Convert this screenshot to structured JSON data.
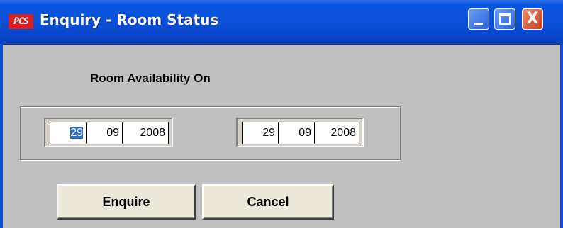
{
  "window": {
    "app_logo": "PCS",
    "title": "Enquiry - Room Status",
    "controls": {
      "minimize_icon": "minimize-icon",
      "maximize_icon": "maximize-icon",
      "close_icon": "close-icon",
      "close_glyph": "X"
    }
  },
  "form": {
    "heading": "Room Availability On",
    "from_date": {
      "day": "29",
      "month": "09",
      "year": "2008"
    },
    "to_date": {
      "day": "29",
      "month": "09",
      "year": "2008"
    }
  },
  "buttons": {
    "enquire": {
      "mnemonic": "E",
      "rest": "nquire"
    },
    "cancel": {
      "mnemonic": "C",
      "rest": "ancel"
    }
  },
  "colors": {
    "titlebar": "#0a4fd8",
    "face": "#c0c0c0",
    "selection": "#316ac5",
    "close_button": "#c8421c"
  }
}
